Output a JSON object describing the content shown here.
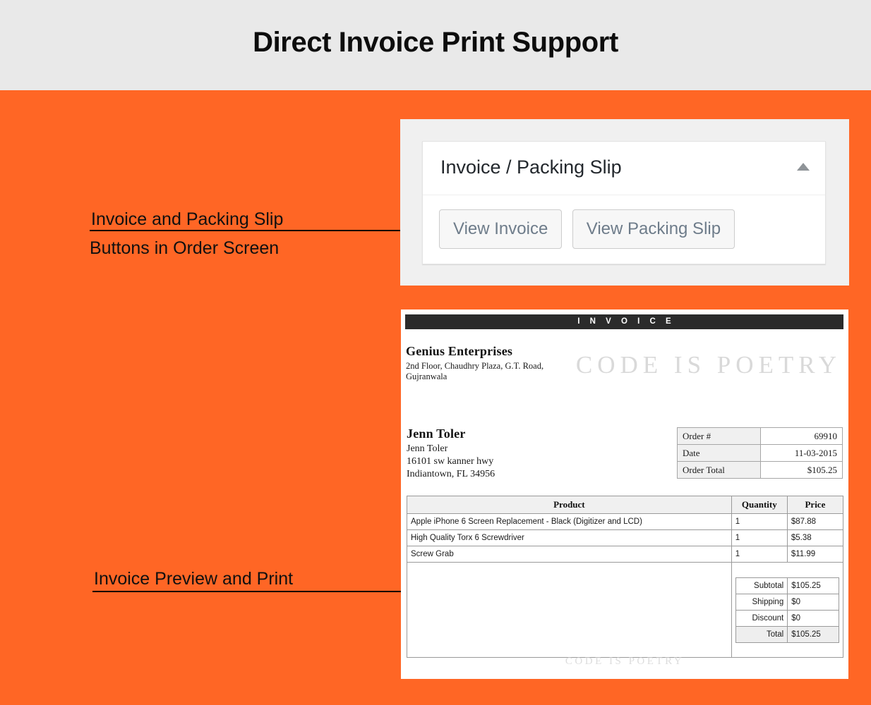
{
  "header": {
    "title": "Direct Invoice Print Support",
    "background": "#E9E9E9"
  },
  "page": {
    "accent_color": "#FF6625"
  },
  "annotations": [
    {
      "line1": "Invoice and Packing Slip",
      "line2": "Buttons in Order Screen"
    },
    {
      "line1": "Invoice Preview and Print"
    }
  ],
  "order_screen_card": {
    "metabox": {
      "title": "Invoice / Packing Slip",
      "toggle_icon": "triangle-up-icon",
      "buttons": [
        {
          "label": "View Invoice"
        },
        {
          "label": "View Packing Slip"
        }
      ]
    }
  },
  "invoice": {
    "banner": "I N V O I C E",
    "company": {
      "name": "Genius Enterprises",
      "address_line1": "2nd Floor, Chaudhry Plaza, G.T. Road,",
      "address_line2": "Gujranwala"
    },
    "watermark_top": "CODE IS POETRY",
    "watermark_bottom": "CODE IS POETRY",
    "customer": {
      "name": "Jenn Toler",
      "line1": "Jenn Toler",
      "line2": "16101 sw kanner hwy",
      "line3": "Indiantown, FL 34956"
    },
    "order_meta": [
      {
        "key": "Order #",
        "value": "69910"
      },
      {
        "key": "Date",
        "value": "11-03-2015"
      },
      {
        "key": "Order Total",
        "value": "$105.25"
      }
    ],
    "products_table": {
      "headers": [
        "Product",
        "Quantity",
        "Price"
      ],
      "rows": [
        {
          "product": "Apple iPhone 6 Screen Replacement - Black (Digitizer and LCD)",
          "quantity": "1",
          "price": "$87.88"
        },
        {
          "product": "High Quality Torx 6 Screwdriver",
          "quantity": "1",
          "price": "$5.38"
        },
        {
          "product": "Screw Grab",
          "quantity": "1",
          "price": "$11.99"
        }
      ]
    },
    "totals": [
      {
        "label": "Subtotal",
        "value": "$105.25"
      },
      {
        "label": "Shipping",
        "value": "$0"
      },
      {
        "label": "Discount",
        "value": "$0"
      },
      {
        "label": "Total",
        "value": "$105.25"
      }
    ]
  }
}
